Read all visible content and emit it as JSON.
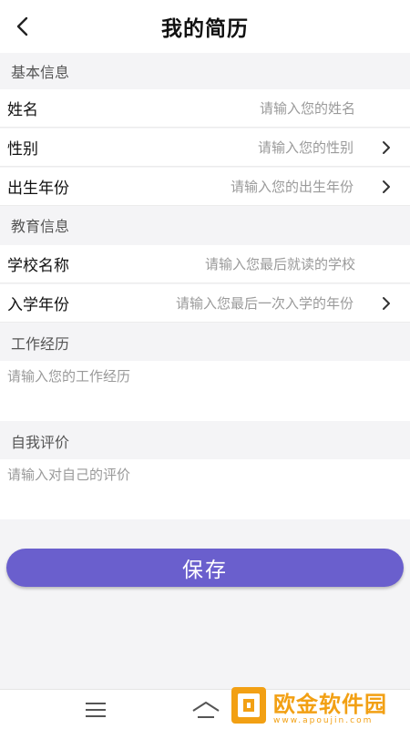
{
  "header": {
    "title": "我的简历",
    "back_icon": "chevron-left-icon"
  },
  "sections": {
    "basic": "基本信息",
    "education": "教育信息",
    "work": "工作经历",
    "self_eval": "自我评价"
  },
  "fields": {
    "name": {
      "label": "姓名",
      "placeholder": "请输入您的姓名"
    },
    "gender": {
      "label": "性别",
      "placeholder": "请输入您的性别"
    },
    "birth_year": {
      "label": "出生年份",
      "placeholder": "请输入您的出生年份"
    },
    "school": {
      "label": "学校名称",
      "placeholder": "请输入您最后就读的学校"
    },
    "enroll_year": {
      "label": "入学年份",
      "placeholder": "请输入您最后一次入学的年份"
    },
    "work_experience": {
      "placeholder": "请输入您的工作经历"
    },
    "self_evaluation": {
      "placeholder": "请输入对自己的评价"
    }
  },
  "actions": {
    "save_label": "保存"
  },
  "navbar": {
    "menu_icon": "menu-icon",
    "home_icon": "home-icon"
  },
  "watermark": {
    "title": "欧金软件园",
    "url": "www.apoujin.com"
  },
  "colors": {
    "accent": "#6a5fcd",
    "background": "#f4f4f6",
    "watermark": "#f2a014"
  }
}
